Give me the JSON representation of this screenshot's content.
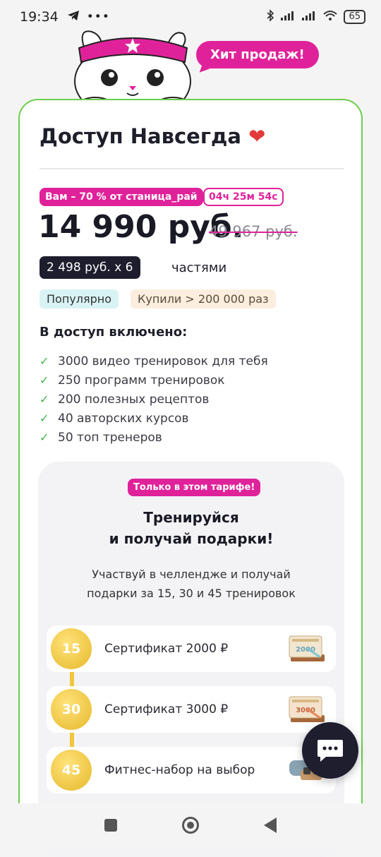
{
  "status_bar": {
    "time": "19:34",
    "battery": "65"
  },
  "mascot": {
    "bubble": "Хит продаж!"
  },
  "card": {
    "title": "Доступ Навсегда",
    "heart": "❤",
    "discount_badge": "Вам – 70 % от станица_рай",
    "timer": "04ч 25м 54с",
    "price": "14 990 руб.",
    "old_price": "49 967 руб.",
    "installment": "2 498 руб. х 6",
    "installment_suffix": "частями",
    "tags": [
      "Популярно",
      "Купили > 200 000 раз"
    ],
    "includes_title": "В доступ включено:",
    "features": [
      "3000 видео тренировок для тебя",
      "250 программ тренировок",
      "200 полезных рецептов",
      "40 авторских курсов",
      "50 топ тренеров"
    ]
  },
  "bonus": {
    "badge": "Только в этом тарифе!",
    "title_line1": "Тренируйся",
    "title_line2": "и получай подарки!",
    "desc_line1": "Участвуй в челлендже и получай",
    "desc_line2": "подарки за 15, 30 и 45 тренировок",
    "steps": [
      {
        "num": "15",
        "label": "Сертификат 2000 ₽",
        "cert": "2000"
      },
      {
        "num": "30",
        "label": "Сертификат 3000 ₽",
        "cert": "3000"
      },
      {
        "num": "45",
        "label": "Фитнес-набор на выбор"
      }
    ]
  },
  "colors": {
    "accent": "#e0229a",
    "border": "#6ccf4d",
    "gold": "#f0c63c",
    "dark": "#1d1d2e"
  }
}
